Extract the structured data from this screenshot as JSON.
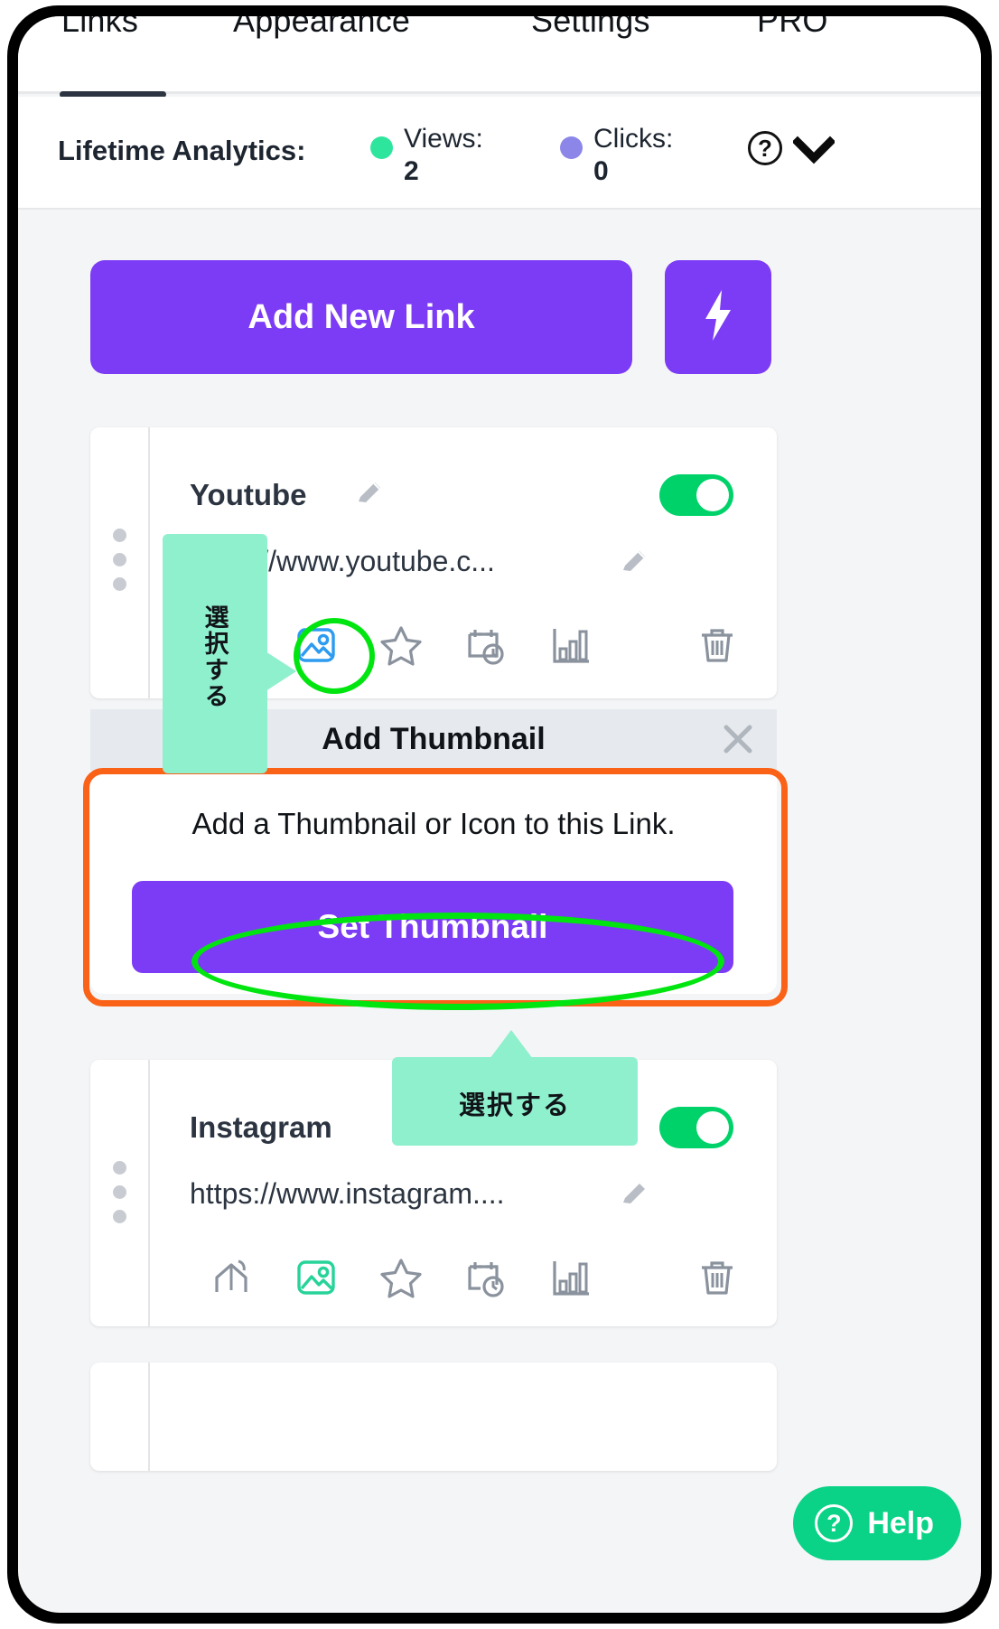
{
  "tabs": [
    {
      "label": "Links",
      "active": true
    },
    {
      "label": "Appearance",
      "active": false
    },
    {
      "label": "Settings",
      "active": false
    },
    {
      "label": "PRO",
      "active": false
    }
  ],
  "analytics": {
    "title": "Lifetime Analytics:",
    "views_label": "Views:",
    "views_value": "2",
    "views_dot_color": "#2ee59d",
    "clicks_label": "Clicks:",
    "clicks_value": "0",
    "clicks_dot_color": "#8b86e8",
    "help_glyph": "?",
    "chevron": "chevron-down-icon"
  },
  "actions": {
    "add_new_link_label": "Add New Link",
    "quick_action_icon": "lightning-bolt-icon",
    "accent_color": "#7c3bf4"
  },
  "links": [
    {
      "title": "Youtube",
      "url": "https://www.youtube.c...",
      "enabled": true,
      "icons": [
        "image-icon",
        "star-icon",
        "calendar-clock-icon",
        "bar-chart-icon",
        "trash-icon"
      ]
    },
    {
      "title": "Instagram",
      "url": "https://www.instagram....",
      "enabled": true,
      "icons": [
        "share-icon",
        "image-icon",
        "star-icon",
        "calendar-clock-icon",
        "bar-chart-icon",
        "trash-icon"
      ]
    }
  ],
  "thumbnail_panel": {
    "header_title": "Add Thumbnail",
    "close_glyph": "✕",
    "description": "Add a Thumbnail or Icon to this Link.",
    "button_label": "Set Thumbnail"
  },
  "annotations": {
    "callout_youtube_text": "選択する",
    "callout_instagram_text": "選択する",
    "callout_color": "#8ff0cd",
    "highlight_ring_color": "#00e510",
    "highlight_box_color": "#fa6218"
  },
  "help_widget": {
    "label": "Help",
    "glyph": "?",
    "color": "#0ad286"
  }
}
